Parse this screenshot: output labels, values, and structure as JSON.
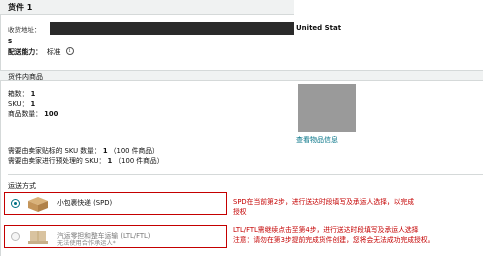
{
  "shipment": {
    "title": "货件 1",
    "address_label": "收货地址：",
    "address_country": "United Stat",
    "address_overflow": "s",
    "capability_label": "配送能力：",
    "capability_value": "标准"
  },
  "products": {
    "section_title": "货件内商品",
    "boxes_label": "箱数：",
    "boxes_value": "1",
    "sku_label": "SKU：",
    "sku_value": "1",
    "qty_label": "商品数量：",
    "qty_value": "100",
    "view_link": "查看物品信息",
    "labeling_label": "需要由卖家贴标的 SKU 数量：",
    "labeling_value": "1",
    "labeling_units": "（100 件商品）",
    "prep_label": "需要由卖家进行预处理的 SKU：",
    "prep_value": "1",
    "prep_units": "（100 件商品）"
  },
  "shipping": {
    "section_title": "运送方式",
    "options": [
      {
        "label": "小包裹快递 (SPD)",
        "sublabel": "",
        "selected": true,
        "disabled": false
      },
      {
        "label": "汽运零担和整车运输 (LTL/FTL)",
        "sublabel": "无法使用合作承运人*",
        "selected": false,
        "disabled": true
      }
    ]
  },
  "notes": {
    "spd_line1": "SPD在当前第2步，进行送达时段填写及承运人选择，以完成",
    "spd_line2": "授权",
    "ltl_line1": "LTL/FTL需继续点击至第4步，进行送达时段填写及承运人选择",
    "ltl_line2": "注意：请勿在第3步提前完成货件创建，您将会无法成功完成授权。"
  },
  "colors": {
    "accent": "#007185",
    "highlight": "#c40000",
    "section_bg": "#f0f2f2"
  }
}
